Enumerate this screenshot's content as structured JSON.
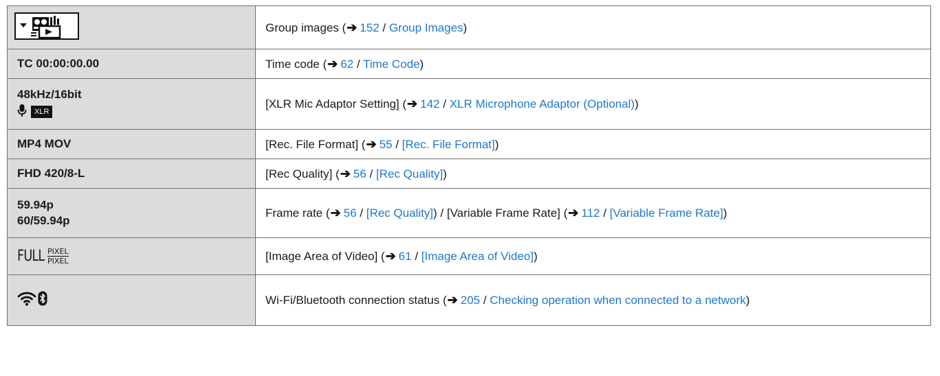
{
  "rows": [
    {
      "left": {
        "icon": "group-images-dropdown-icon"
      },
      "desc": {
        "pre": "Group images (",
        "page": "152",
        "sep": " / ",
        "link": "Group Images",
        "post": ")"
      }
    },
    {
      "left": {
        "text": "TC 00:00:00.00"
      },
      "desc": {
        "pre": "Time code (",
        "page": "62",
        "sep": " / ",
        "link": "Time Code",
        "post": ")"
      }
    },
    {
      "left": {
        "line1": "48kHz/16bit",
        "badge": "XLR",
        "icon": "microphone-icon"
      },
      "desc": {
        "pre": "[XLR Mic Adaptor Setting] (",
        "page": "142",
        "sep": " / ",
        "link": "XLR Microphone Adaptor (Optional)",
        "post": ")"
      }
    },
    {
      "left": {
        "text": "MP4 MOV"
      },
      "desc": {
        "pre": "[Rec. File Format] (",
        "page": "55",
        "sep": " / ",
        "link": "[Rec. File Format]",
        "post": ")"
      }
    },
    {
      "left": {
        "text": "FHD 420/8-L"
      },
      "desc": {
        "pre": "[Rec Quality] (",
        "page": "56",
        "sep": " / ",
        "link": "[Rec Quality]",
        "post": ")"
      }
    },
    {
      "left": {
        "line1": "59.94p",
        "line2": "60/59.94p"
      },
      "desc": {
        "pre": "Frame rate (",
        "page": "56",
        "sep": " / ",
        "link": "[Rec Quality]",
        "mid": ") / [Variable Frame Rate] (",
        "page2": "112",
        "sep2": " / ",
        "link2": "[Variable Frame Rate]",
        "post": ")"
      }
    },
    {
      "left": {
        "word": "FULL",
        "frac_top": "PIXEL",
        "frac_bottom": "PIXEL"
      },
      "desc": {
        "pre": "[Image Area of Video] (",
        "page": "61",
        "sep": " / ",
        "link": "[Image Area of Video]",
        "post": ")"
      }
    },
    {
      "left": {
        "icon": "wifi-bluetooth-status-icon"
      },
      "desc": {
        "pre": "Wi-Fi/Bluetooth connection status (",
        "page": "205",
        "sep": " / ",
        "link": "Checking operation when connected to a network",
        "post": ")"
      }
    }
  ],
  "arrow_glyph": "➔",
  "colors": {
    "link": "#1f78c8",
    "left_bg": "#dcdcdc",
    "border": "#6e6e6e"
  }
}
